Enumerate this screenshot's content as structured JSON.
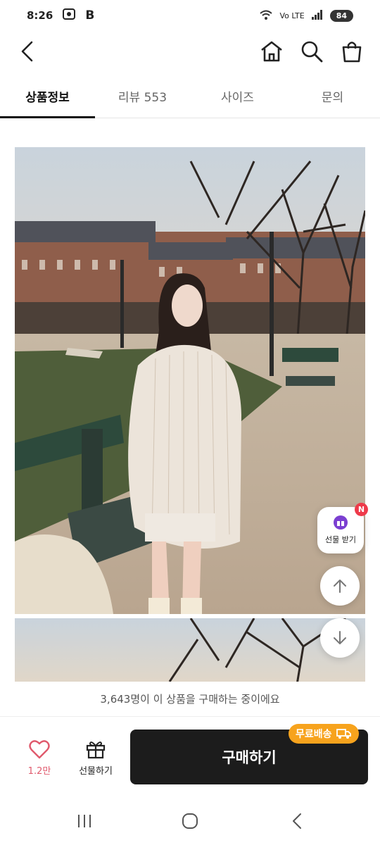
{
  "status_bar": {
    "time": "8:26",
    "network": "Vo LTE",
    "battery": "84"
  },
  "app_bar": {
    "icons": [
      "back-icon",
      "home-icon",
      "search-icon",
      "shopping-bag-icon"
    ]
  },
  "tabs": [
    {
      "label": "상품정보",
      "active": true
    },
    {
      "label": "리뷰 553",
      "active": false
    },
    {
      "label": "사이즈",
      "active": false
    },
    {
      "label": "문의",
      "active": false
    }
  ],
  "floating": {
    "gift_label": "선물 받기",
    "badge": "N"
  },
  "purchase_banner": "3,643명이 이 상품을 구매하는 중이에요",
  "bottom_bar": {
    "like_count": "1.2만",
    "gift_label": "선물하기",
    "buy_label": "구매하기",
    "free_shipping": "무료배송"
  },
  "colors": {
    "accent_like": "#e05a6d",
    "free_shipping_badge": "#f7a31d",
    "buy_button": "#1c1c1c",
    "notification_badge": "#ee3a4a"
  }
}
